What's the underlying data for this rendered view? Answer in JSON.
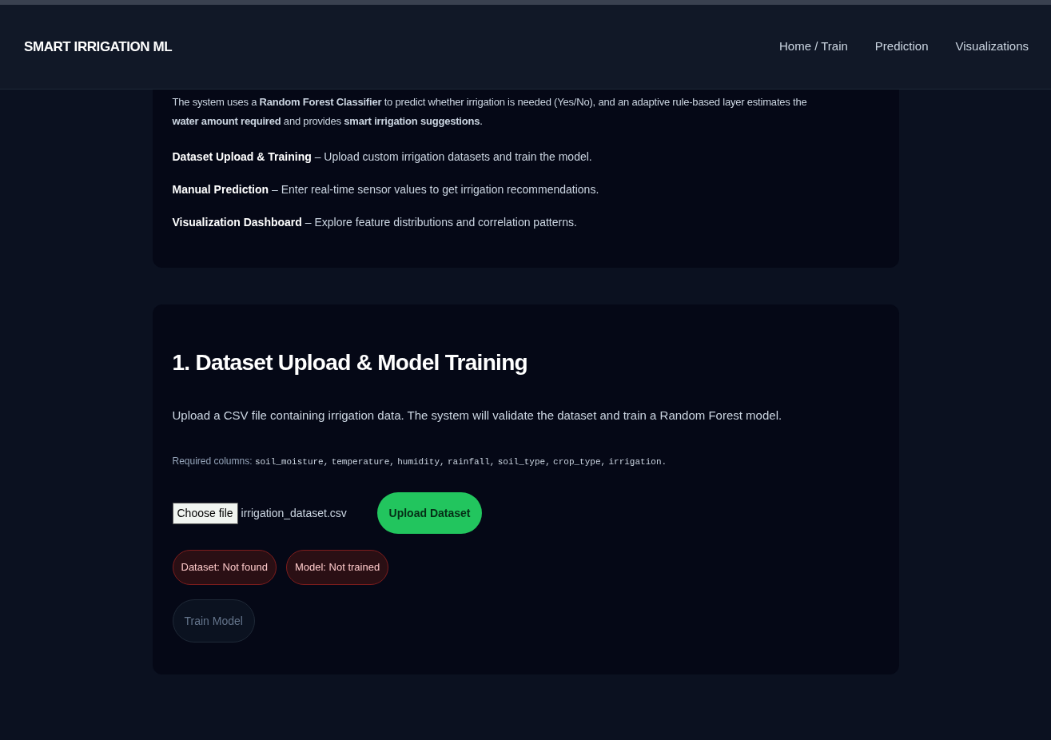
{
  "navbar": {
    "brand": "SMART IRRIGATION ML",
    "links": [
      {
        "label": "Home / Train",
        "selected": false
      },
      {
        "label": "Prediction",
        "selected": false
      },
      {
        "label": "Visualizations",
        "selected": false
      }
    ]
  },
  "intro": {
    "lines": [
      "The system uses a **Random Forest Classifier** to predict whether irrigation is needed (Yes/No), and an adaptive rule-based layer estimates the",
      "**water amount required** and provides **smart irrigation suggestions**."
    ],
    "features": [
      {
        "title": "Dataset Upload & Training",
        "description": " – Upload custom irrigation datasets and train the model."
      },
      {
        "title": "Manual Prediction",
        "description": " – Enter real-time sensor values to get irrigation recommendations."
      },
      {
        "title": "Visualization Dashboard",
        "description": " – Explore feature distributions and correlation patterns."
      }
    ]
  },
  "upload_section": {
    "title": "1. Dataset Upload & Model Training",
    "description": "Upload a CSV file containing irrigation data. The system will validate the dataset and train a Random Forest model.",
    "required_label": "Required columns:",
    "columns": [
      "soil_moisture,",
      "temperature,",
      "humidity,",
      "rainfall,",
      "soil_type,",
      "crop_type,",
      "irrigation."
    ],
    "file_input": {
      "button": "Choose file",
      "value": "irrigation_dataset.csv"
    },
    "upload_button": {
      "label": "Upload Dataset",
      "disabled": false
    },
    "status_badges": [
      {
        "label": "Dataset: Not found",
        "kind": "error"
      },
      {
        "label": "Model: Not trained",
        "kind": "error"
      }
    ],
    "train_button": {
      "label": "Train Model",
      "disabled": true
    }
  }
}
